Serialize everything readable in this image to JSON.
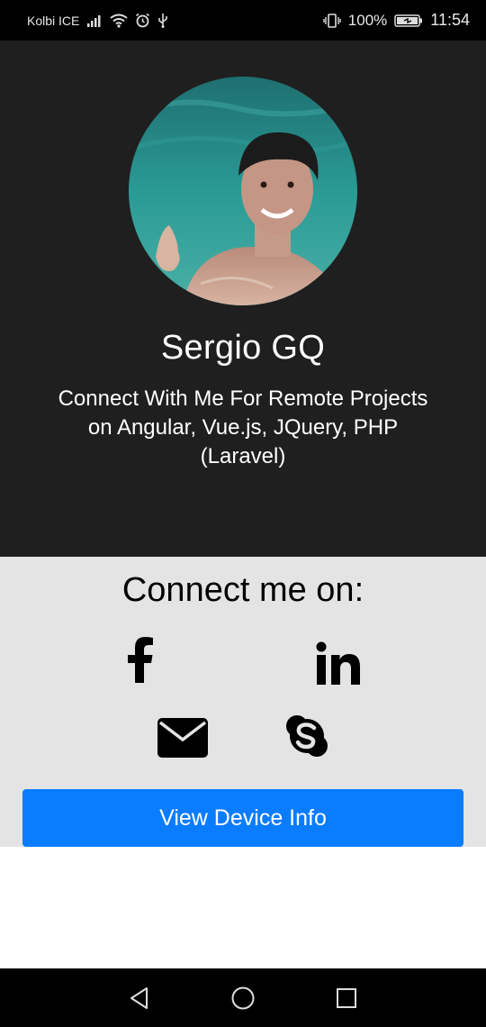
{
  "status_bar": {
    "carrier": "Kolbi ICE",
    "battery": "100%",
    "time": "11:54",
    "icons": [
      "signal-icon",
      "wifi-icon",
      "alarm-icon",
      "usb-icon",
      "vibrate-icon",
      "battery-icon"
    ]
  },
  "profile": {
    "name": "Sergio GQ",
    "tagline": "Connect With Me For Remote Projects on Angular, Vue.js, JQuery, PHP (Laravel)",
    "avatar_icon": "profile-photo"
  },
  "connect": {
    "title": "Connect me on:",
    "links": [
      {
        "icon": "facebook-icon"
      },
      {
        "icon": "linkedin-icon"
      },
      {
        "icon": "email-icon"
      },
      {
        "icon": "skype-icon"
      }
    ],
    "button_label": "View Device Info"
  },
  "colors": {
    "hero_bg": "#1f1f1f",
    "connect_bg": "#e4e4e4",
    "button_bg": "#0a7cff",
    "bars_bg": "#000000"
  },
  "nav_bar": {
    "icons": [
      "back-icon",
      "home-icon",
      "recents-icon"
    ]
  }
}
